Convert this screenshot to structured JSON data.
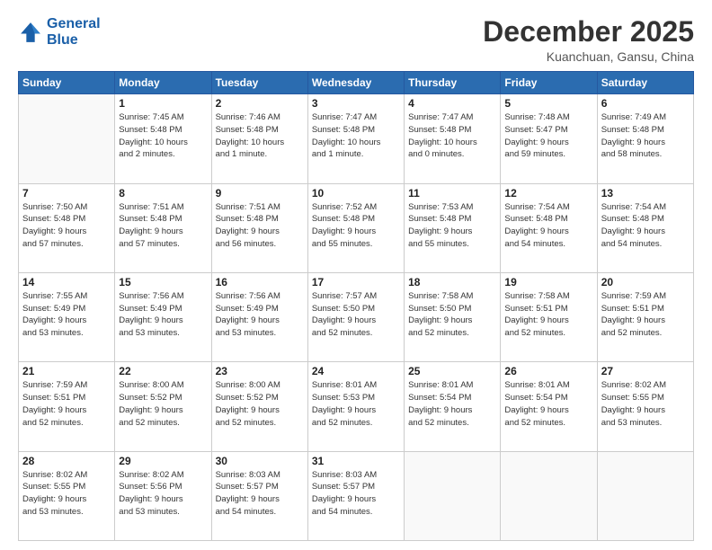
{
  "logo": {
    "line1": "General",
    "line2": "Blue"
  },
  "title": "December 2025",
  "location": "Kuanchuan, Gansu, China",
  "days_of_week": [
    "Sunday",
    "Monday",
    "Tuesday",
    "Wednesday",
    "Thursday",
    "Friday",
    "Saturday"
  ],
  "weeks": [
    [
      {
        "day": "",
        "info": ""
      },
      {
        "day": "1",
        "info": "Sunrise: 7:45 AM\nSunset: 5:48 PM\nDaylight: 10 hours\nand 2 minutes."
      },
      {
        "day": "2",
        "info": "Sunrise: 7:46 AM\nSunset: 5:48 PM\nDaylight: 10 hours\nand 1 minute."
      },
      {
        "day": "3",
        "info": "Sunrise: 7:47 AM\nSunset: 5:48 PM\nDaylight: 10 hours\nand 1 minute."
      },
      {
        "day": "4",
        "info": "Sunrise: 7:47 AM\nSunset: 5:48 PM\nDaylight: 10 hours\nand 0 minutes."
      },
      {
        "day": "5",
        "info": "Sunrise: 7:48 AM\nSunset: 5:47 PM\nDaylight: 9 hours\nand 59 minutes."
      },
      {
        "day": "6",
        "info": "Sunrise: 7:49 AM\nSunset: 5:48 PM\nDaylight: 9 hours\nand 58 minutes."
      }
    ],
    [
      {
        "day": "7",
        "info": "Sunrise: 7:50 AM\nSunset: 5:48 PM\nDaylight: 9 hours\nand 57 minutes."
      },
      {
        "day": "8",
        "info": "Sunrise: 7:51 AM\nSunset: 5:48 PM\nDaylight: 9 hours\nand 57 minutes."
      },
      {
        "day": "9",
        "info": "Sunrise: 7:51 AM\nSunset: 5:48 PM\nDaylight: 9 hours\nand 56 minutes."
      },
      {
        "day": "10",
        "info": "Sunrise: 7:52 AM\nSunset: 5:48 PM\nDaylight: 9 hours\nand 55 minutes."
      },
      {
        "day": "11",
        "info": "Sunrise: 7:53 AM\nSunset: 5:48 PM\nDaylight: 9 hours\nand 55 minutes."
      },
      {
        "day": "12",
        "info": "Sunrise: 7:54 AM\nSunset: 5:48 PM\nDaylight: 9 hours\nand 54 minutes."
      },
      {
        "day": "13",
        "info": "Sunrise: 7:54 AM\nSunset: 5:48 PM\nDaylight: 9 hours\nand 54 minutes."
      }
    ],
    [
      {
        "day": "14",
        "info": "Sunrise: 7:55 AM\nSunset: 5:49 PM\nDaylight: 9 hours\nand 53 minutes."
      },
      {
        "day": "15",
        "info": "Sunrise: 7:56 AM\nSunset: 5:49 PM\nDaylight: 9 hours\nand 53 minutes."
      },
      {
        "day": "16",
        "info": "Sunrise: 7:56 AM\nSunset: 5:49 PM\nDaylight: 9 hours\nand 53 minutes."
      },
      {
        "day": "17",
        "info": "Sunrise: 7:57 AM\nSunset: 5:50 PM\nDaylight: 9 hours\nand 52 minutes."
      },
      {
        "day": "18",
        "info": "Sunrise: 7:58 AM\nSunset: 5:50 PM\nDaylight: 9 hours\nand 52 minutes."
      },
      {
        "day": "19",
        "info": "Sunrise: 7:58 AM\nSunset: 5:51 PM\nDaylight: 9 hours\nand 52 minutes."
      },
      {
        "day": "20",
        "info": "Sunrise: 7:59 AM\nSunset: 5:51 PM\nDaylight: 9 hours\nand 52 minutes."
      }
    ],
    [
      {
        "day": "21",
        "info": "Sunrise: 7:59 AM\nSunset: 5:51 PM\nDaylight: 9 hours\nand 52 minutes."
      },
      {
        "day": "22",
        "info": "Sunrise: 8:00 AM\nSunset: 5:52 PM\nDaylight: 9 hours\nand 52 minutes."
      },
      {
        "day": "23",
        "info": "Sunrise: 8:00 AM\nSunset: 5:52 PM\nDaylight: 9 hours\nand 52 minutes."
      },
      {
        "day": "24",
        "info": "Sunrise: 8:01 AM\nSunset: 5:53 PM\nDaylight: 9 hours\nand 52 minutes."
      },
      {
        "day": "25",
        "info": "Sunrise: 8:01 AM\nSunset: 5:54 PM\nDaylight: 9 hours\nand 52 minutes."
      },
      {
        "day": "26",
        "info": "Sunrise: 8:01 AM\nSunset: 5:54 PM\nDaylight: 9 hours\nand 52 minutes."
      },
      {
        "day": "27",
        "info": "Sunrise: 8:02 AM\nSunset: 5:55 PM\nDaylight: 9 hours\nand 53 minutes."
      }
    ],
    [
      {
        "day": "28",
        "info": "Sunrise: 8:02 AM\nSunset: 5:55 PM\nDaylight: 9 hours\nand 53 minutes."
      },
      {
        "day": "29",
        "info": "Sunrise: 8:02 AM\nSunset: 5:56 PM\nDaylight: 9 hours\nand 53 minutes."
      },
      {
        "day": "30",
        "info": "Sunrise: 8:03 AM\nSunset: 5:57 PM\nDaylight: 9 hours\nand 54 minutes."
      },
      {
        "day": "31",
        "info": "Sunrise: 8:03 AM\nSunset: 5:57 PM\nDaylight: 9 hours\nand 54 minutes."
      },
      {
        "day": "",
        "info": ""
      },
      {
        "day": "",
        "info": ""
      },
      {
        "day": "",
        "info": ""
      }
    ]
  ]
}
